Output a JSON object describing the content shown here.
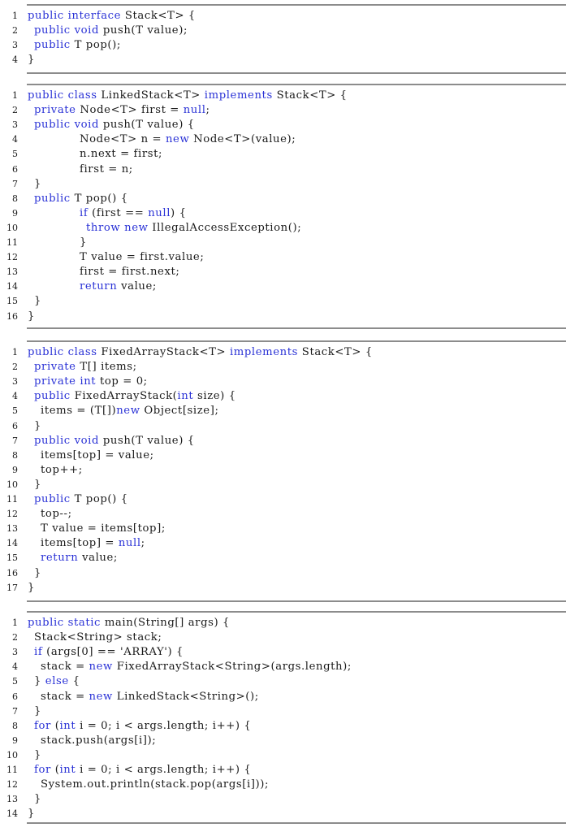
{
  "listings": [
    {
      "name": "stack-interface",
      "lines": [
        {
          "n": "1",
          "indent": 0,
          "t": [
            [
              "public interface",
              1
            ],
            [
              " Stack<T> {",
              0
            ]
          ]
        },
        {
          "n": "2",
          "indent": 1,
          "t": [
            [
              "public void",
              1
            ],
            [
              " push(T value);",
              0
            ]
          ]
        },
        {
          "n": "3",
          "indent": 1,
          "t": [
            [
              "public",
              1
            ],
            [
              " T pop();",
              0
            ]
          ]
        },
        {
          "n": "4",
          "indent": 0,
          "t": [
            [
              "}",
              0
            ]
          ]
        }
      ]
    },
    {
      "name": "linked-stack",
      "lines": [
        {
          "n": "1",
          "indent": 0,
          "t": [
            [
              "public class",
              1
            ],
            [
              " LinkedStack<T> ",
              0
            ],
            [
              "implements",
              1
            ],
            [
              " Stack<T> {",
              0
            ]
          ]
        },
        {
          "n": "2",
          "indent": 1,
          "t": [
            [
              "private",
              1
            ],
            [
              " Node<T> first = ",
              0
            ],
            [
              "null",
              1
            ],
            [
              ";",
              0
            ]
          ]
        },
        {
          "n": "3",
          "indent": 1,
          "t": [
            [
              "public void",
              1
            ],
            [
              " push(T value) {",
              0
            ]
          ]
        },
        {
          "n": "4",
          "indent": 8,
          "t": [
            [
              "Node<T> n = ",
              0
            ],
            [
              "new",
              1
            ],
            [
              " Node<T>(value);",
              0
            ]
          ]
        },
        {
          "n": "5",
          "indent": 8,
          "t": [
            [
              "n.next = first;",
              0
            ]
          ]
        },
        {
          "n": "6",
          "indent": 8,
          "t": [
            [
              "first = n;",
              0
            ]
          ]
        },
        {
          "n": "7",
          "indent": 1,
          "t": [
            [
              "}",
              0
            ]
          ]
        },
        {
          "n": "8",
          "indent": 1,
          "t": [
            [
              "public",
              1
            ],
            [
              " T pop() {",
              0
            ]
          ]
        },
        {
          "n": "9",
          "indent": 8,
          "t": [
            [
              "if",
              1
            ],
            [
              " (first == ",
              0
            ],
            [
              "null",
              1
            ],
            [
              ") {",
              0
            ]
          ]
        },
        {
          "n": "10",
          "indent": 9,
          "t": [
            [
              "throw new",
              1
            ],
            [
              " IllegalAccessException();",
              0
            ]
          ]
        },
        {
          "n": "11",
          "indent": 8,
          "t": [
            [
              "}",
              0
            ]
          ]
        },
        {
          "n": "12",
          "indent": 8,
          "t": [
            [
              "T value = first.value;",
              0
            ]
          ]
        },
        {
          "n": "13",
          "indent": 8,
          "t": [
            [
              "first = first.next;",
              0
            ]
          ]
        },
        {
          "n": "14",
          "indent": 8,
          "t": [
            [
              "return",
              1
            ],
            [
              " value;",
              0
            ]
          ]
        },
        {
          "n": "15",
          "indent": 1,
          "t": [
            [
              "}",
              0
            ]
          ]
        },
        {
          "n": "16",
          "indent": 0,
          "t": [
            [
              "}",
              0
            ]
          ]
        }
      ]
    },
    {
      "name": "fixed-array-stack",
      "lines": [
        {
          "n": "1",
          "indent": 0,
          "t": [
            [
              "public class",
              1
            ],
            [
              " FixedArrayStack<T> ",
              0
            ],
            [
              "implements",
              1
            ],
            [
              " Stack<T> {",
              0
            ]
          ]
        },
        {
          "n": "2",
          "indent": 1,
          "t": [
            [
              "private",
              1
            ],
            [
              " T[] items;",
              0
            ]
          ]
        },
        {
          "n": "3",
          "indent": 1,
          "t": [
            [
              "private int",
              1
            ],
            [
              " top = 0;",
              0
            ]
          ]
        },
        {
          "n": "4",
          "indent": 1,
          "t": [
            [
              "public",
              1
            ],
            [
              " FixedArrayStack(",
              0
            ],
            [
              "int",
              1
            ],
            [
              " size) {",
              0
            ]
          ]
        },
        {
          "n": "5",
          "indent": 2,
          "t": [
            [
              "items = (T[])",
              0
            ],
            [
              "new",
              1
            ],
            [
              " Object[size];",
              0
            ]
          ]
        },
        {
          "n": "6",
          "indent": 1,
          "t": [
            [
              "}",
              0
            ]
          ]
        },
        {
          "n": "7",
          "indent": 1,
          "t": [
            [
              "public void",
              1
            ],
            [
              " push(T value) {",
              0
            ]
          ]
        },
        {
          "n": "8",
          "indent": 2,
          "t": [
            [
              "items[top] = value;",
              0
            ]
          ]
        },
        {
          "n": "9",
          "indent": 2,
          "t": [
            [
              "top++;",
              0
            ]
          ]
        },
        {
          "n": "10",
          "indent": 1,
          "t": [
            [
              "}",
              0
            ]
          ]
        },
        {
          "n": "11",
          "indent": 1,
          "t": [
            [
              "public",
              1
            ],
            [
              " T pop() {",
              0
            ]
          ]
        },
        {
          "n": "12",
          "indent": 2,
          "t": [
            [
              "top--;",
              0
            ]
          ]
        },
        {
          "n": "13",
          "indent": 2,
          "t": [
            [
              "T value = items[top];",
              0
            ]
          ]
        },
        {
          "n": "14",
          "indent": 2,
          "t": [
            [
              "items[top] = ",
              0
            ],
            [
              "null",
              1
            ],
            [
              ";",
              0
            ]
          ]
        },
        {
          "n": "15",
          "indent": 2,
          "t": [
            [
              "return",
              1
            ],
            [
              " value;",
              0
            ]
          ]
        },
        {
          "n": "16",
          "indent": 1,
          "t": [
            [
              "}",
              0
            ]
          ]
        },
        {
          "n": "17",
          "indent": 0,
          "t": [
            [
              "}",
              0
            ]
          ]
        }
      ]
    },
    {
      "name": "main-method",
      "lines": [
        {
          "n": "1",
          "indent": 0,
          "t": [
            [
              "public static",
              1
            ],
            [
              " main(String[] args) {",
              0
            ]
          ]
        },
        {
          "n": "2",
          "indent": 1,
          "t": [
            [
              "Stack<String> stack;",
              0
            ]
          ]
        },
        {
          "n": "3",
          "indent": 1,
          "t": [
            [
              "if",
              1
            ],
            [
              " (args[0] == 'ARRAY') {",
              0
            ]
          ]
        },
        {
          "n": "4",
          "indent": 2,
          "t": [
            [
              "stack = ",
              0
            ],
            [
              "new",
              1
            ],
            [
              " FixedArrayStack<String>(args.length);",
              0
            ]
          ]
        },
        {
          "n": "5",
          "indent": 1,
          "t": [
            [
              "} ",
              0
            ],
            [
              "else",
              1
            ],
            [
              " {",
              0
            ]
          ]
        },
        {
          "n": "6",
          "indent": 2,
          "t": [
            [
              "stack = ",
              0
            ],
            [
              "new",
              1
            ],
            [
              " LinkedStack<String>();",
              0
            ]
          ]
        },
        {
          "n": "7",
          "indent": 1,
          "t": [
            [
              "}",
              0
            ]
          ]
        },
        {
          "n": "8",
          "indent": 1,
          "t": [
            [
              "for",
              1
            ],
            [
              " (",
              0
            ],
            [
              "int",
              1
            ],
            [
              " i = 0; i < args.length; i++) {",
              0
            ]
          ]
        },
        {
          "n": "9",
          "indent": 2,
          "t": [
            [
              "stack.push(args[i]);",
              0
            ]
          ]
        },
        {
          "n": "10",
          "indent": 1,
          "t": [
            [
              "}",
              0
            ]
          ]
        },
        {
          "n": "11",
          "indent": 1,
          "t": [
            [
              "for",
              1
            ],
            [
              " (",
              0
            ],
            [
              "int",
              1
            ],
            [
              " i = 0; i < args.length; i++) {",
              0
            ]
          ]
        },
        {
          "n": "12",
          "indent": 2,
          "t": [
            [
              "System.out.println(stack.pop(args[i]));",
              0
            ]
          ]
        },
        {
          "n": "13",
          "indent": 1,
          "t": [
            [
              "}",
              0
            ]
          ]
        },
        {
          "n": "14",
          "indent": 0,
          "t": [
            [
              "}",
              0
            ]
          ]
        }
      ]
    }
  ],
  "colors": {
    "keyword": "#2a32d6",
    "text": "#1a1a1a",
    "rule": "#8c8c8c"
  }
}
